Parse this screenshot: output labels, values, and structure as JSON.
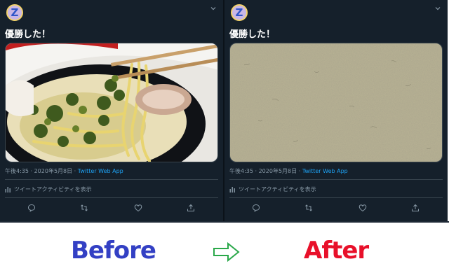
{
  "panels": [
    {
      "id": "before",
      "avatar_letter": "Z",
      "tweet_text": "優勝した！",
      "media": "ramen-photo",
      "time": "午後4:35 · 2020年5月8日 · ",
      "app": "Twitter Web App",
      "activity": "ツイートアクティビティを表示"
    },
    {
      "id": "after",
      "avatar_letter": "Z",
      "tweet_text": "優勝した！",
      "media": "paper-texture",
      "time": "午後4:35 · 2020年5月8日 · ",
      "app": "Twitter Web App",
      "activity": "ツイートアクティビティを表示"
    }
  ],
  "icons": {
    "reply": "reply-icon",
    "retweet": "retweet-icon",
    "like": "like-icon",
    "share": "share-icon",
    "activity": "bar-chart-icon",
    "menu": "chevron-down-icon"
  },
  "captions": {
    "before": "Before",
    "after": "After"
  },
  "colors": {
    "background": "#15202b",
    "link": "#1da1f2",
    "muted": "#8899a6",
    "before_caption": "#3340c4",
    "after_caption": "#e8102a",
    "arrow": "#2aa84a"
  }
}
